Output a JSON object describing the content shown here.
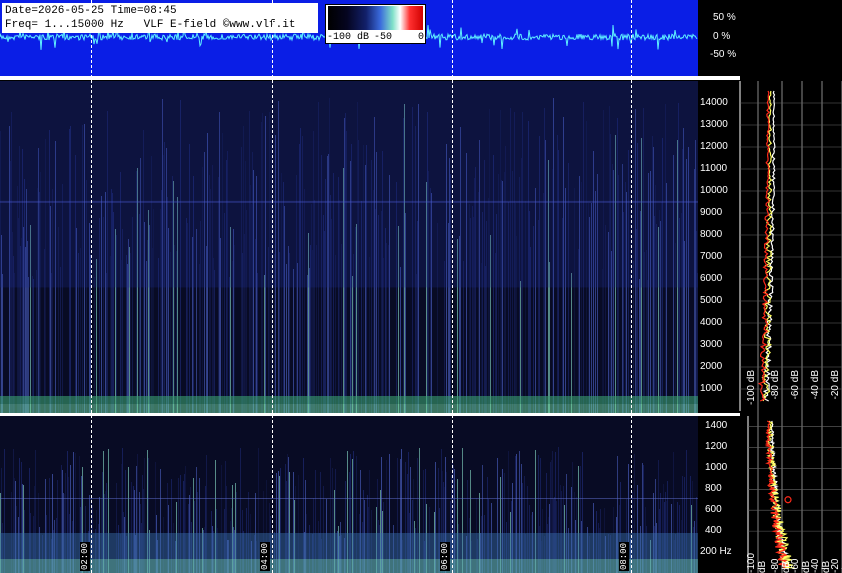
{
  "info": {
    "line1": "Date=2026-05-25 Time=08:45",
    "line2": "Freq= 1...15000 Hz   VLF E-field ©www.vlf.it"
  },
  "colorbar": {
    "labels": [
      "-100 dB",
      "-50",
      "0"
    ]
  },
  "waveform_axis": {
    "labels": [
      "50 %",
      "0 %",
      "-50 %"
    ]
  },
  "chart_data": [
    {
      "type": "heatmap",
      "title": "",
      "xlabel": "",
      "ylabel": "",
      "x_ticks": [
        "02:00",
        "04:00",
        "06:00",
        "08:00"
      ],
      "y_ticks": [
        14000,
        13000,
        12000,
        11000,
        10000,
        9000,
        8000,
        7000,
        6000,
        5000,
        4000,
        3000,
        2000,
        1000
      ],
      "ylim": [
        0,
        15000
      ]
    },
    {
      "type": "heatmap",
      "title": "",
      "xlabel": "",
      "ylabel": "",
      "x_ticks": [
        "02:00",
        "04:00",
        "06:00",
        "08:00"
      ],
      "y_ticks": [
        1400,
        1200,
        1000,
        800,
        600,
        400
      ],
      "y_unit_label": "200 Hz",
      "ylim": [
        0,
        1500
      ]
    },
    {
      "type": "line",
      "title": "",
      "x_ticks": [
        "-100 dB",
        "-80 dB",
        "-60 dB",
        "-40 dB",
        "-20 dB"
      ]
    }
  ],
  "colors": {
    "waveform_bg": "#0a1ee6",
    "waveform_line": "#5ff0ff",
    "spectrum_red": "#ff2a1a",
    "spectrum_yellow": "#ffff60",
    "spectrum_white": "#ffffff"
  }
}
